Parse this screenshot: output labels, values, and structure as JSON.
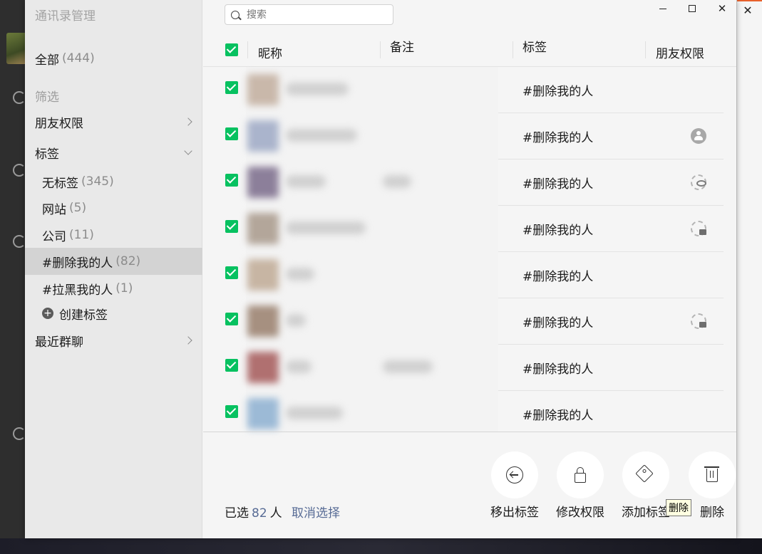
{
  "sidebar": {
    "title": "通讯录管理",
    "all": {
      "label": "全部",
      "count": "(444)"
    },
    "filter_label": "筛选",
    "friend_perm": "朋友权限",
    "tags_label": "标签",
    "tags": [
      {
        "label": "无标签",
        "count": "(345)"
      },
      {
        "label": "网站",
        "count": "(5)"
      },
      {
        "label": "公司",
        "count": "(11)"
      },
      {
        "label": "#删除我的人",
        "count": "(82)"
      },
      {
        "label": "#拉黑我的人",
        "count": "(1)"
      }
    ],
    "create_tag": "创建标签",
    "recent_groups": "最近群聊"
  },
  "search": {
    "placeholder": "搜索"
  },
  "table": {
    "headers": {
      "nickname": "昵称",
      "remark": "备注",
      "tag": "标签",
      "permission": "朋友权限"
    },
    "rows": [
      {
        "tag": "#删除我的人",
        "permission": "none"
      },
      {
        "tag": "#删除我的人",
        "permission": "user-icon"
      },
      {
        "tag": "#删除我的人",
        "permission": "hide-icon"
      },
      {
        "tag": "#删除我的人",
        "permission": "lock-icon"
      },
      {
        "tag": "#删除我的人",
        "permission": "none"
      },
      {
        "tag": "#删除我的人",
        "permission": "lock-icon"
      },
      {
        "tag": "#删除我的人",
        "permission": "none"
      },
      {
        "tag": "#删除我的人",
        "permission": "none"
      }
    ]
  },
  "footer": {
    "selected_prefix": "已选",
    "selected_count": "82",
    "selected_suffix": "人",
    "deselect": "取消选择"
  },
  "actions": {
    "remove_tag": "移出标签",
    "modify_perm": "修改权限",
    "add_tag": "添加标签",
    "delete": "删除"
  },
  "tooltip": "删除",
  "colors": {
    "accent": "#07c160",
    "link": "#576b95"
  }
}
